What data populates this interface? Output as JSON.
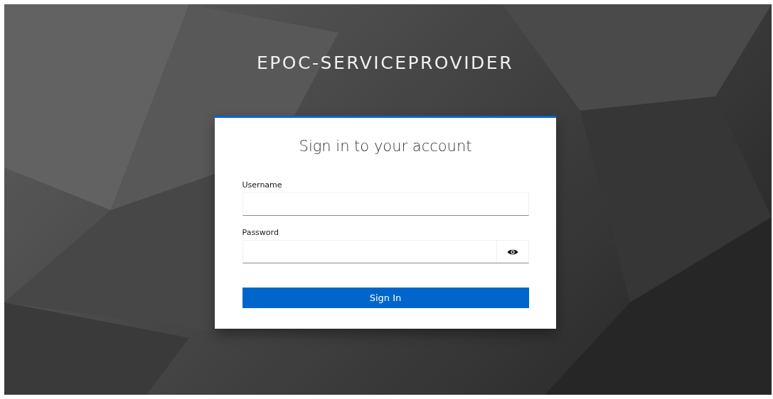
{
  "realm_title": "EPOC-SERVICEPROVIDER",
  "login_card": {
    "heading": "Sign in to your account",
    "fields": [
      {
        "kind": "text",
        "label": "Username"
      },
      {
        "kind": "password",
        "label": "Password"
      }
    ],
    "submit_button": "Sign In"
  }
}
